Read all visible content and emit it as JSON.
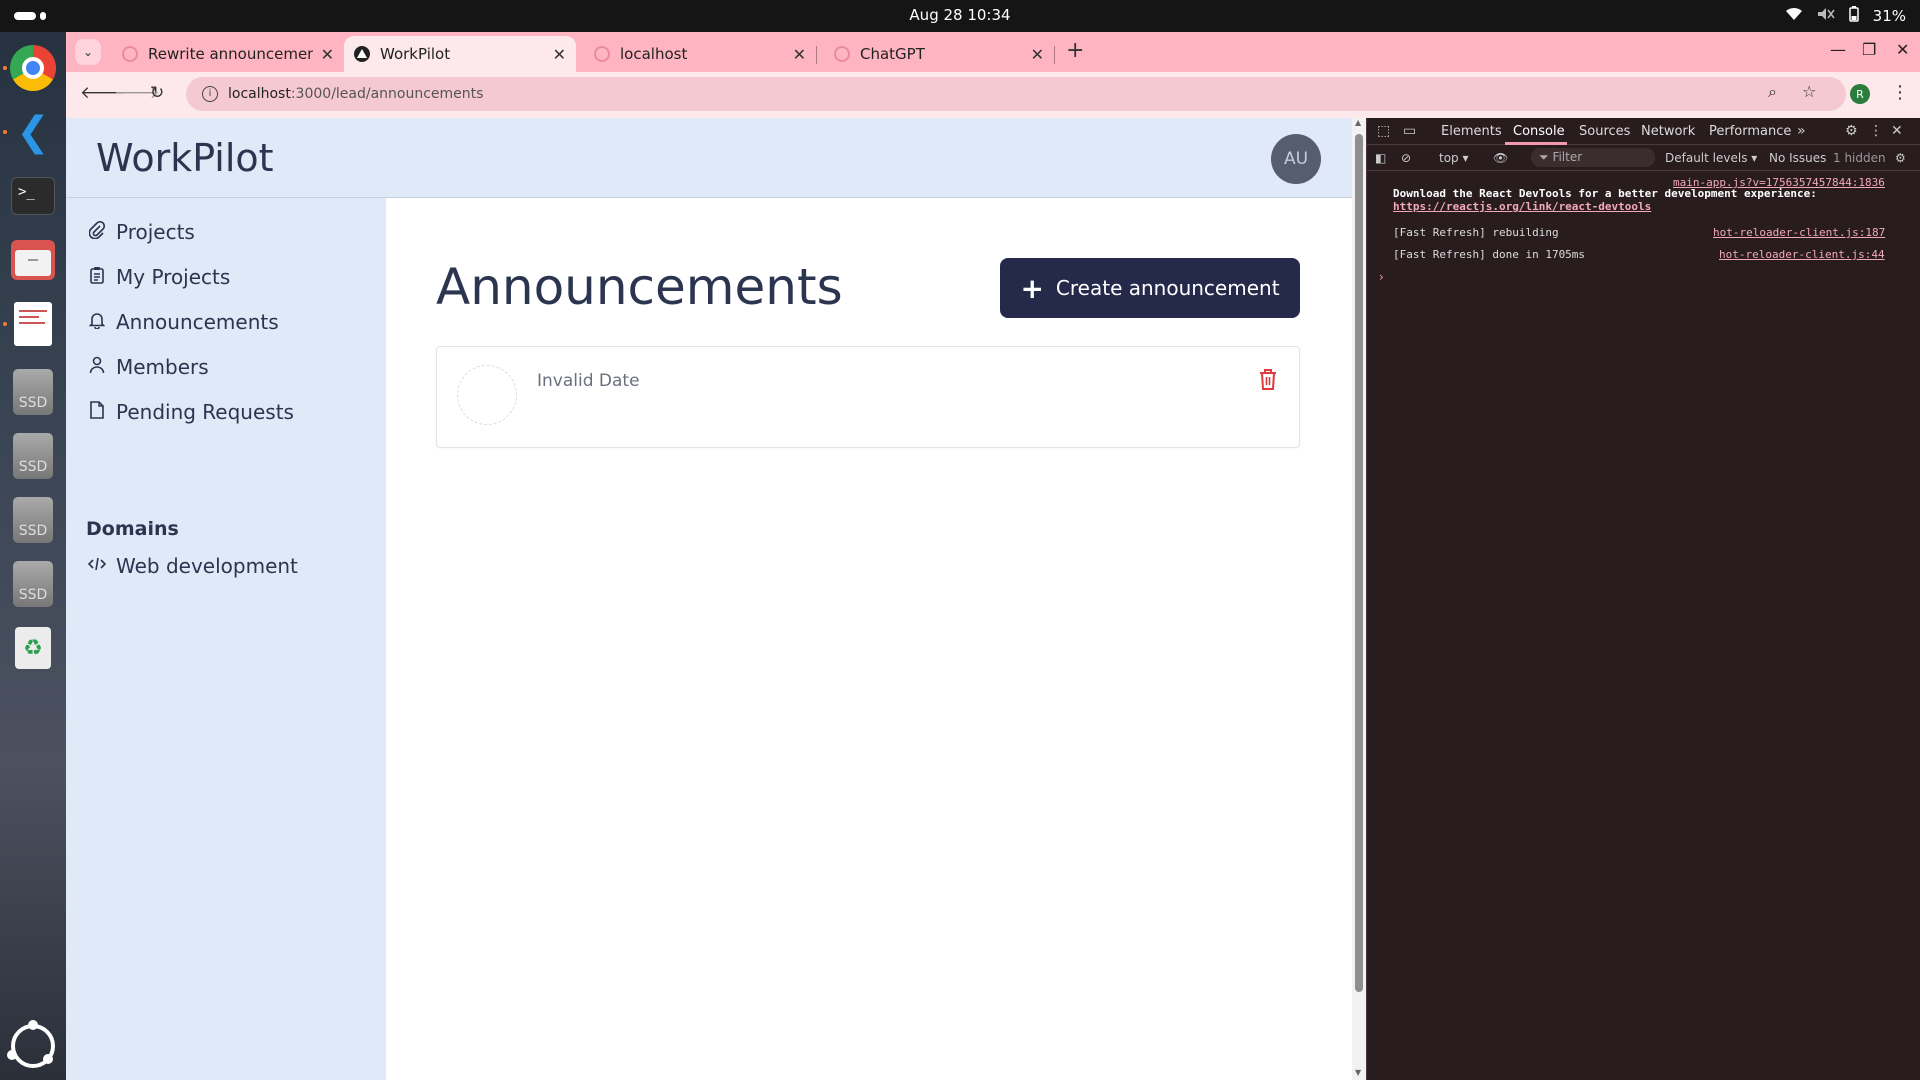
{
  "system": {
    "clock": "Aug 28  10:34",
    "battery": "31%"
  },
  "dock": {
    "items": [
      "Google Chrome",
      "Visual Studio Code",
      "Terminal",
      "Files",
      "Document Viewer",
      "SSD",
      "SSD",
      "SSD",
      "SSD",
      "Trash",
      "Show Apps"
    ],
    "ssd_label": "SSD"
  },
  "browser": {
    "tabs": [
      {
        "title": "Rewrite announcements",
        "active": false
      },
      {
        "title": "WorkPilot",
        "active": true
      },
      {
        "title": "localhost",
        "active": false
      },
      {
        "title": "ChatGPT",
        "active": false
      }
    ],
    "url_host": "localhost",
    "url_path": ":3000/lead/announcements",
    "profile_initial": "R"
  },
  "app": {
    "brand": "WorkPilot",
    "avatar_initials": "AU",
    "nav": [
      {
        "label": "Projects",
        "icon": "paperclip-icon"
      },
      {
        "label": "My Projects",
        "icon": "clipboard-icon"
      },
      {
        "label": "Announcements",
        "icon": "bell-icon"
      },
      {
        "label": "Members",
        "icon": "user-icon"
      },
      {
        "label": "Pending Requests",
        "icon": "file-icon"
      }
    ],
    "domains_heading": "Domains",
    "domains": [
      {
        "label": "Web development",
        "icon": "code-icon"
      }
    ],
    "page_title": "Announcements",
    "create_button": "Create announcement",
    "announcements": [
      {
        "date": "Invalid Date"
      }
    ]
  },
  "devtools": {
    "tabs": [
      "Elements",
      "Console",
      "Sources",
      "Network",
      "Performance"
    ],
    "active_tab": "Console",
    "context": "top",
    "filter_placeholder": "Filter",
    "levels": "Default levels",
    "issues": "No Issues",
    "hidden": "1 hidden",
    "logs": [
      {
        "source": "main-app.js?v=1756357457844:1836",
        "text": "Download the React DevTools for a better development experience:",
        "link": "https://reactjs.org/link/react-devtools"
      },
      {
        "source": "hot-reloader-client.js:187",
        "text": "[Fast Refresh] rebuilding"
      },
      {
        "source": "hot-reloader-client.js:44",
        "text": "[Fast Refresh] done in 1705ms"
      }
    ]
  },
  "colors": {
    "tabstrip": "#ffb4c2",
    "sidebar": "#dfe9f8",
    "primary_button": "#262a4a",
    "delete": "#e03a3a"
  }
}
